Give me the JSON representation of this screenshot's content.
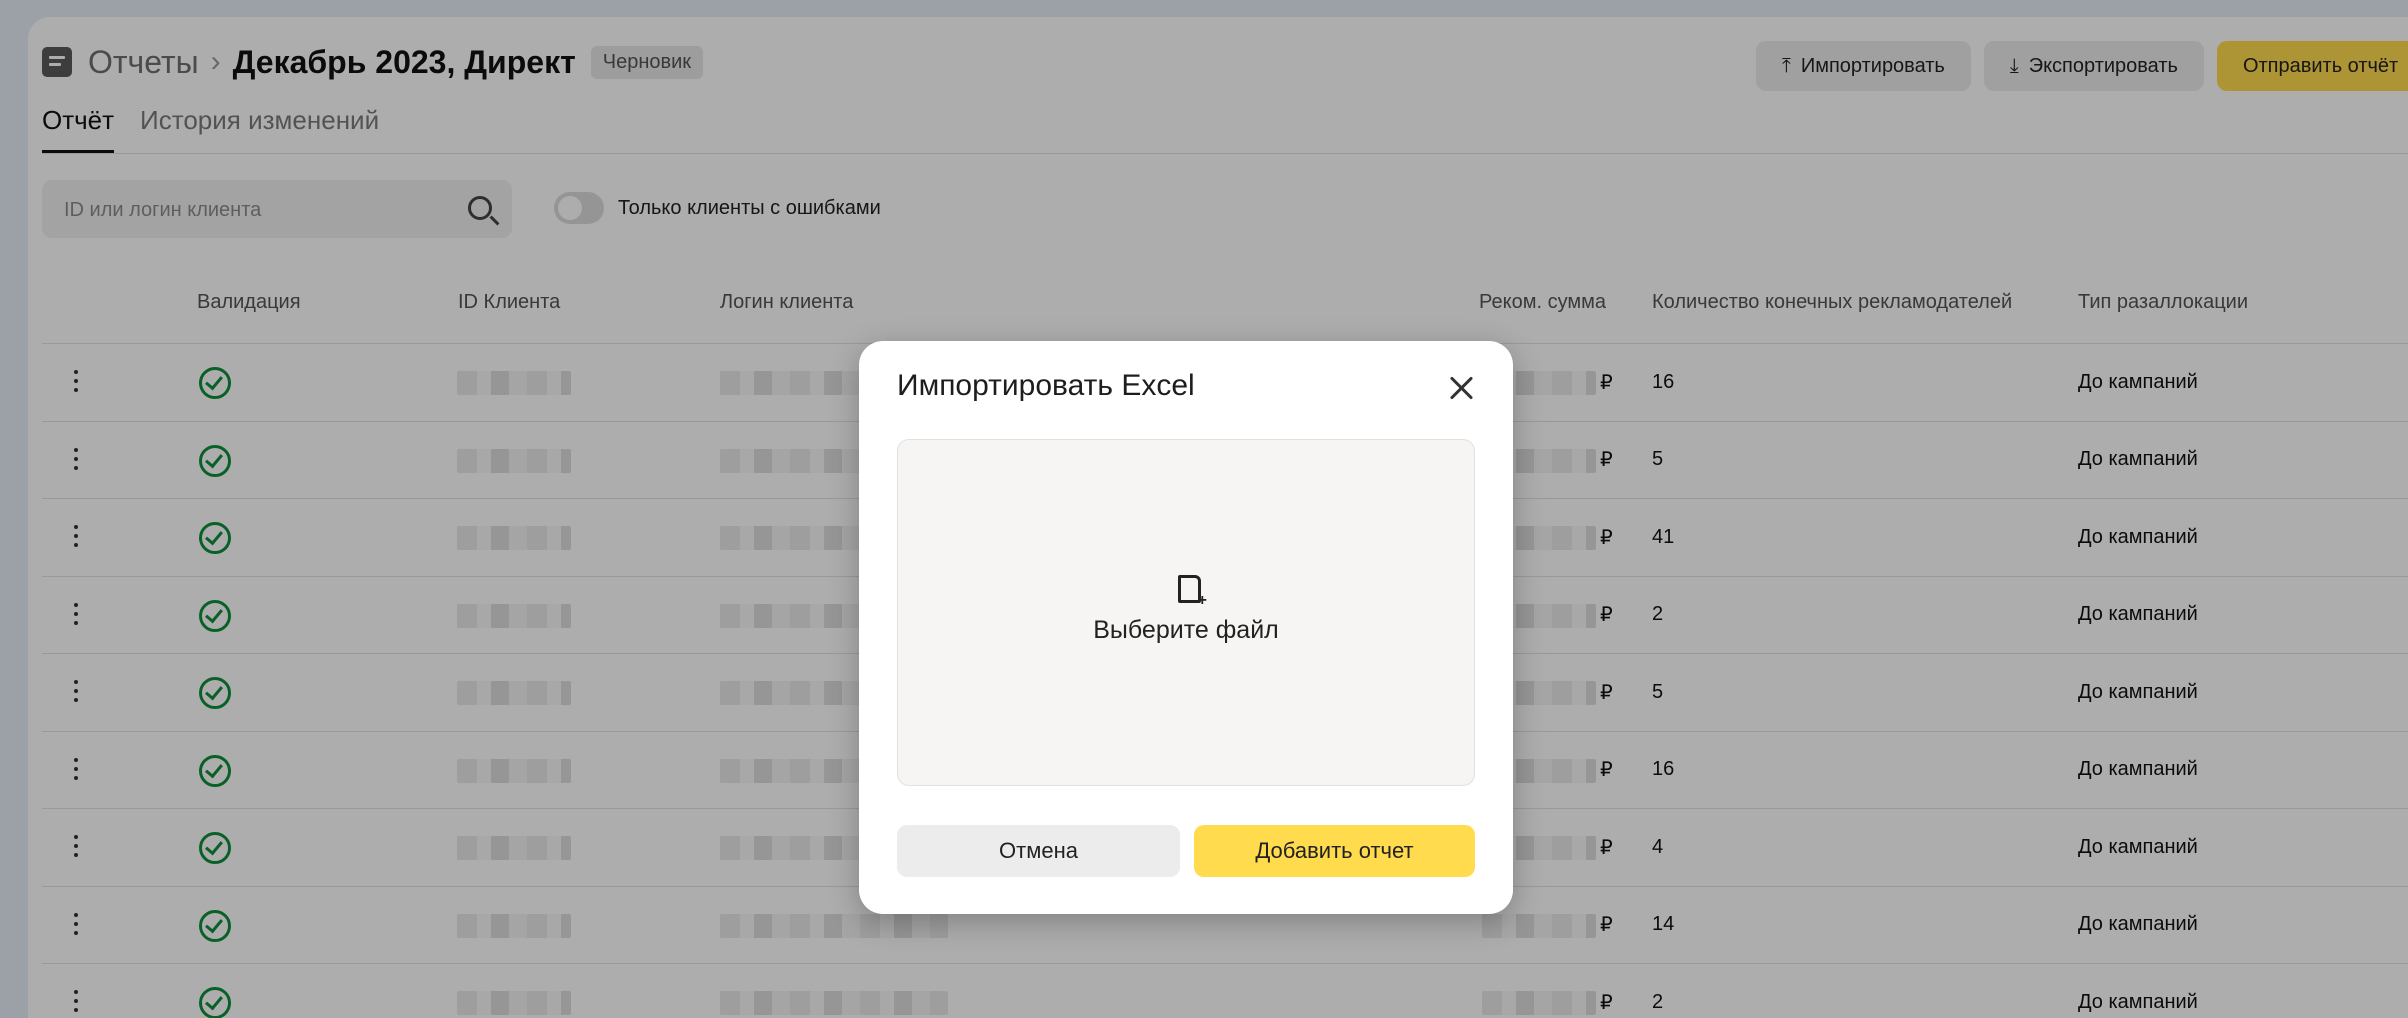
{
  "header": {
    "breadcrumb_root": "Отчеты",
    "breadcrumb_separator": "›",
    "title": "Декабрь 2023, Директ",
    "badge": "Черновик",
    "import_label": "Импортировать",
    "export_label": "Экспортировать",
    "send_label": "Отправить отчёт"
  },
  "tabs": [
    {
      "label": "Отчёт",
      "active": true
    },
    {
      "label": "История изменений",
      "active": false
    }
  ],
  "filters": {
    "search_placeholder": "ID или логин клиента",
    "toggle_label": "Только клиенты с ошибками",
    "toggle_on": false
  },
  "table": {
    "columns": [
      "Валидация",
      "ID Клиента",
      "Логин клиента",
      "Реком. сумма",
      "Количество конечных рекламодателей",
      "Тип разаллокации"
    ],
    "currency": "₽",
    "rows": [
      {
        "advertisers": "16",
        "type": "До кампаний"
      },
      {
        "advertisers": "5",
        "type": "До кампаний"
      },
      {
        "advertisers": "41",
        "type": "До кампаний"
      },
      {
        "advertisers": "2",
        "type": "До кампаний"
      },
      {
        "advertisers": "5",
        "type": "До кампаний"
      },
      {
        "advertisers": "16",
        "type": "До кампаний"
      },
      {
        "advertisers": "4",
        "type": "До кампаний"
      },
      {
        "advertisers": "14",
        "type": "До кампаний"
      },
      {
        "advertisers": "2",
        "type": "До кампаний"
      }
    ]
  },
  "modal": {
    "title": "Импортировать Excel",
    "dropzone_label": "Выберите файл",
    "cancel_label": "Отмена",
    "submit_label": "Добавить отчет"
  },
  "colors": {
    "accent_yellow": "#ffdb4d",
    "validation_green": "#0f8f3a",
    "page_background": "#e6ecf7"
  },
  "icons": {
    "header": "report-icon",
    "import": "upload-icon",
    "export": "download-icon",
    "search": "search-icon",
    "row_menu": "kebab-menu-icon",
    "validation": "check-circle-icon",
    "close": "close-icon",
    "file": "file-add-icon"
  }
}
